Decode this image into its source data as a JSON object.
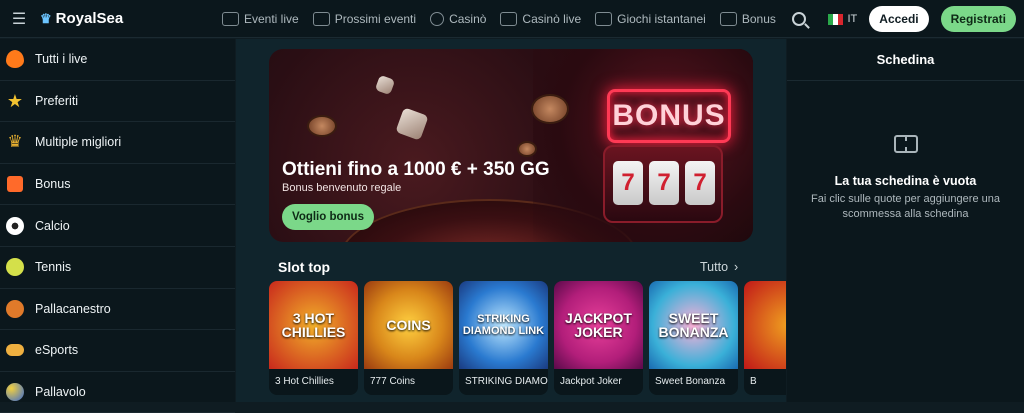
{
  "brand": {
    "name": "RoyalSea"
  },
  "nav": [
    {
      "label": "Eventi live",
      "icon": "live-events-icon"
    },
    {
      "label": "Prossimi eventi",
      "icon": "calendar-icon"
    },
    {
      "label": "Casinò",
      "icon": "casino-chip-icon"
    },
    {
      "label": "Casinò live",
      "icon": "cards-icon"
    },
    {
      "label": "Giochi istantanei",
      "icon": "rocket-icon"
    },
    {
      "label": "Bonus",
      "icon": "gift-icon"
    }
  ],
  "header": {
    "language": "IT",
    "login_label": "Accedi",
    "register_label": "Registrati"
  },
  "sidebar": {
    "items": [
      {
        "label": "Tutti i live",
        "icon": "fire-icon",
        "color": "#ff7a1a"
      },
      {
        "label": "Preferiti",
        "icon": "star-icon",
        "color": "#f2c230"
      },
      {
        "label": "Multiple migliori",
        "icon": "crown-icon",
        "color": "#e8b030"
      },
      {
        "label": "Bonus",
        "icon": "gift-icon",
        "color": "#ff6a2a"
      },
      {
        "label": "Calcio",
        "icon": "soccer-ball-icon",
        "color": "#ffffff"
      },
      {
        "label": "Tennis",
        "icon": "tennis-ball-icon",
        "color": "#d4e04a"
      },
      {
        "label": "Pallacanestro",
        "icon": "basketball-icon",
        "color": "#e07a2a"
      },
      {
        "label": "eSports",
        "icon": "gamepad-icon",
        "color": "#f0b040"
      },
      {
        "label": "Pallavolo",
        "icon": "volleyball-icon",
        "color": "#f2d040"
      }
    ]
  },
  "banner": {
    "title": "Ottieni fino a 1000 € + 350 GG",
    "subtitle": "Bonus benvenuto regale",
    "cta": "Voglio bonus",
    "sign": "BONUS",
    "reels": [
      "7",
      "7",
      "7"
    ]
  },
  "slots": {
    "title": "Slot top",
    "all_label": "Tutto",
    "games": [
      {
        "name": "3 Hot Chillies",
        "art": "3 HOT CHILLIES",
        "color": "#c8281c"
      },
      {
        "name": "777 Coins",
        "art": "COINS",
        "color": "#d8861a"
      },
      {
        "name": "STRIKING DIAMO...",
        "art": "STRIKING DIAMOND LINK",
        "color": "#2a7ad0"
      },
      {
        "name": "Jackpot Joker",
        "art": "JACKPOT JOKER",
        "color": "#b21e7a"
      },
      {
        "name": "Sweet Bonanza",
        "art": "SWEET BONANZA",
        "color": "#3ab0d8"
      },
      {
        "name": "B",
        "art": "",
        "color": "#c01818"
      }
    ]
  },
  "betslip": {
    "title": "Schedina",
    "empty_title": "La tua schedina è vuota",
    "empty_hint": "Fai clic sulle quote per aggiungere una scommessa alla schedina"
  }
}
